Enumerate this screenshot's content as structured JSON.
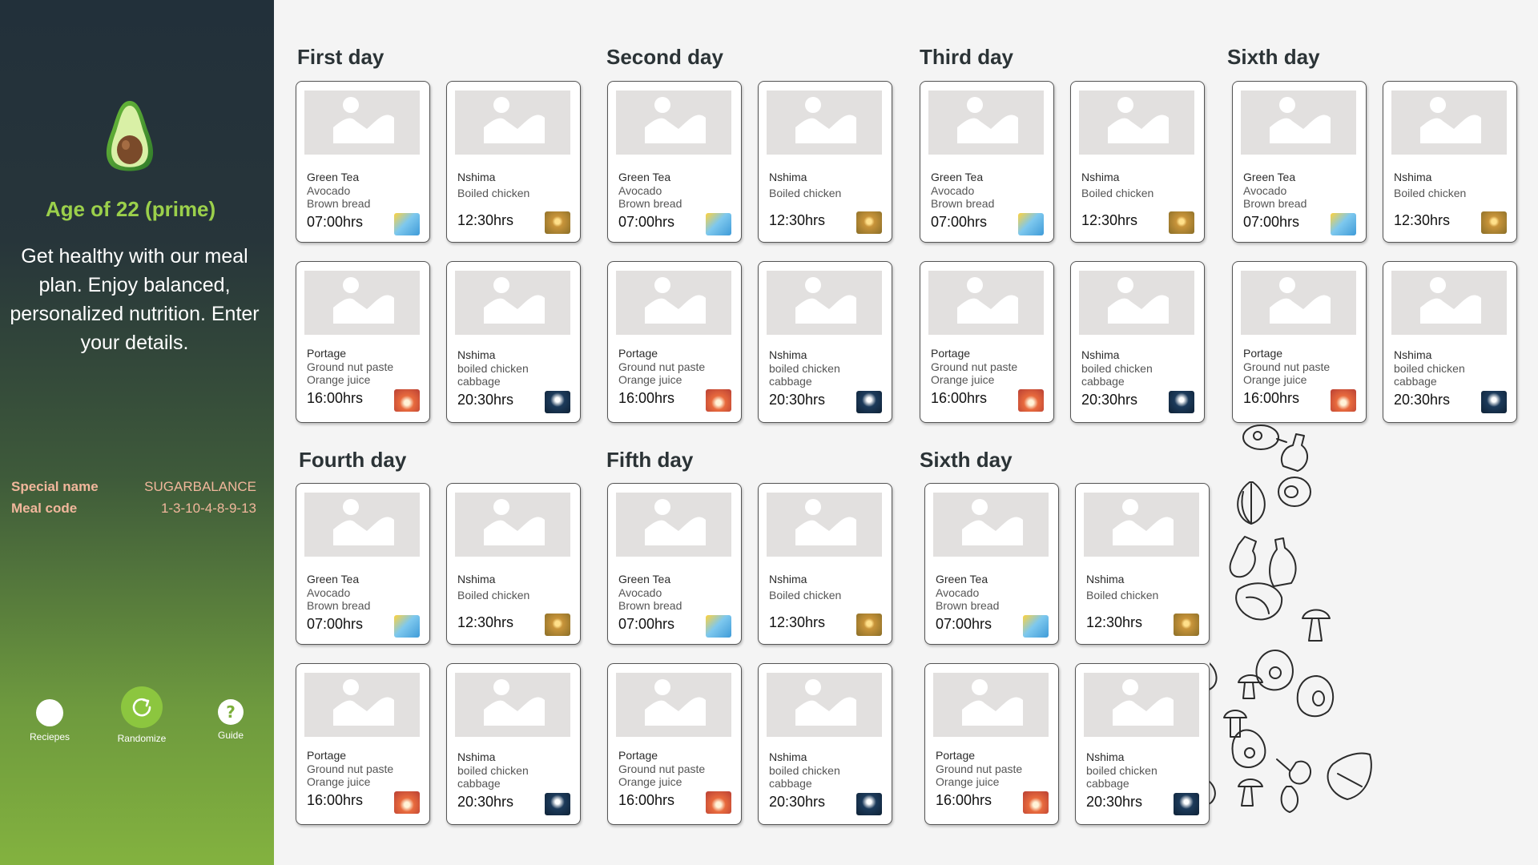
{
  "sidebar": {
    "age_title": "Age of 22  (prime)",
    "tagline": "Get healthy with our meal plan. Enjoy balanced, personalized nutrition. Enter your details.",
    "special_name_label": "Special name",
    "special_name_value": "SUGARBALANCE",
    "meal_code_label": "Meal code",
    "meal_code_value": "1-3-10-4-8-9-13",
    "nav": {
      "recipes": "Reciepes",
      "randomize": "Randomize",
      "guide": "Guide"
    }
  },
  "meals": {
    "breakfast": {
      "name": "Green Tea",
      "items": "Avocado\nBrown bread",
      "time": "07:00hrs",
      "icon": "sunrise-icon"
    },
    "lunch": {
      "name": "Nshima",
      "items": "Boiled chicken",
      "time": "12:30hrs",
      "icon": "noon-sun-icon"
    },
    "snack": {
      "name": "Portage",
      "items": "Ground nut paste\nOrange juice",
      "time": "16:00hrs",
      "icon": "sunset-icon"
    },
    "dinner": {
      "name": "Nshima",
      "items": "boiled chicken\ncabbage",
      "time": "20:30hrs",
      "icon": "moon-night-icon"
    }
  },
  "days": [
    "First day",
    "Second day",
    "Third day",
    "Sixth day",
    "Fourth day",
    "Fifth day",
    "Sixth day"
  ],
  "colors": {
    "accent_green": "#8cc63f",
    "sidebar_dark": "#22303a",
    "label_salmon": "#f1b79c"
  }
}
